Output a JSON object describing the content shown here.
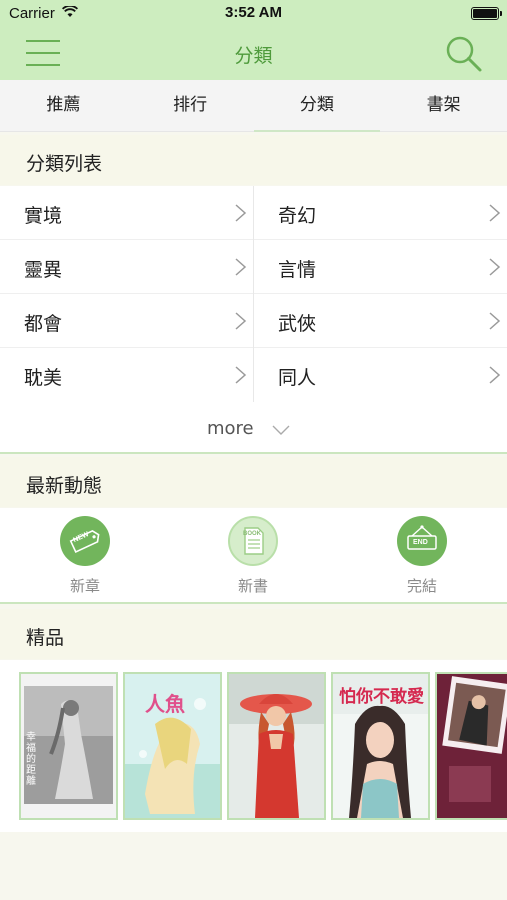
{
  "status_bar": {
    "carrier": "Carrier",
    "time": "3:52 AM"
  },
  "nav": {
    "title": "分類"
  },
  "tabs": [
    {
      "label": "推薦",
      "active": false
    },
    {
      "label": "排行",
      "active": false
    },
    {
      "label": "分類",
      "active": true
    },
    {
      "label": "書架",
      "active": false
    }
  ],
  "category_section": {
    "title": "分類列表",
    "items": [
      "實境",
      "奇幻",
      "靈異",
      "言情",
      "都會",
      "武俠",
      "耽美",
      "同人"
    ],
    "more_label": "more"
  },
  "latest_section": {
    "title": "最新動態",
    "items": [
      {
        "label": "新章",
        "icon": "new-tag-icon",
        "badge": "NEW"
      },
      {
        "label": "新書",
        "icon": "book-icon",
        "badge": "BOOK"
      },
      {
        "label": "完結",
        "icon": "end-sign-icon",
        "badge": "END"
      }
    ]
  },
  "featured_section": {
    "title": "精品",
    "books": [
      {
        "cover_text": "幸福的距離"
      },
      {
        "cover_text": "人魚"
      },
      {
        "cover_text": ""
      },
      {
        "cover_text": "怕你不敢愛"
      },
      {
        "cover_text": ""
      }
    ]
  },
  "colors": {
    "accent": "#6ab056",
    "nav_bg": "#cdedbf",
    "title_green": "#4e9a3b",
    "divider_green": "#cbe6bf"
  }
}
